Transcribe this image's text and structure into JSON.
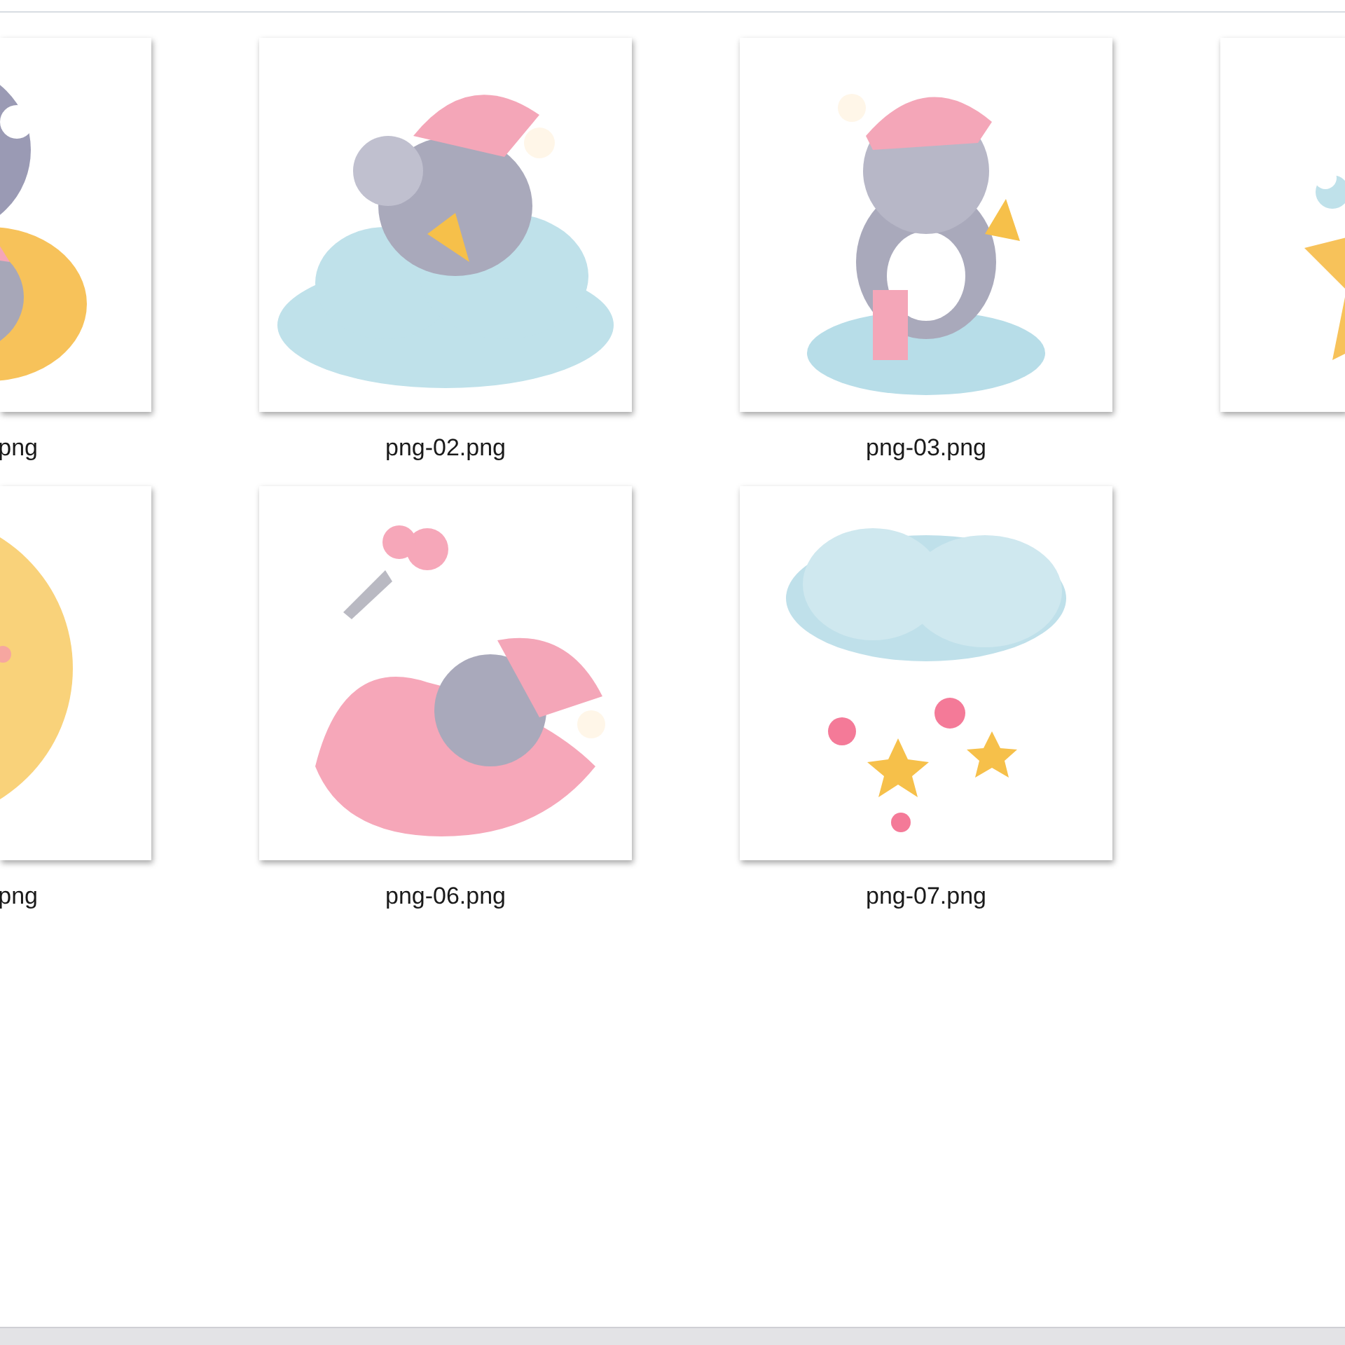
{
  "files": [
    {
      "kind": "partial-left",
      "name": "png"
    },
    {
      "kind": "full",
      "name": "png-02.png"
    },
    {
      "kind": "full",
      "name": "png-03.png"
    },
    {
      "kind": "partial-right"
    },
    {
      "kind": "partial-left",
      "name": "png"
    },
    {
      "kind": "full",
      "name": "png-06.png"
    },
    {
      "kind": "full",
      "name": "png-07.png"
    }
  ]
}
